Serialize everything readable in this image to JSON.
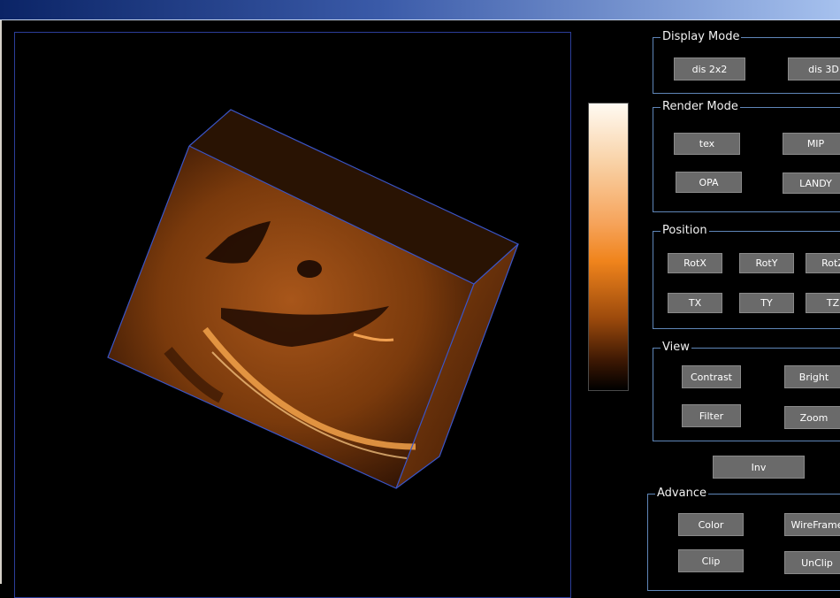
{
  "window": {
    "title": ""
  },
  "display_mode": {
    "title": "Display Mode",
    "buttons": [
      "dis 2x2",
      "dis 3D"
    ]
  },
  "render_mode": {
    "title": "Render Mode",
    "buttons": [
      "tex",
      "MIP",
      "OPA",
      "LANDY"
    ]
  },
  "position": {
    "title": "Position",
    "buttons": [
      "RotX",
      "RotY",
      "RotZ",
      "TX",
      "TY",
      "TZ"
    ]
  },
  "view": {
    "title": "View",
    "buttons": [
      "Contrast",
      "Bright",
      "Filter",
      "Zoom"
    ]
  },
  "inv_button": "Inv",
  "advance": {
    "title": "Advance",
    "buttons": [
      "Color",
      "WireFrame",
      "Clip",
      "UnClip"
    ]
  },
  "colormap": {
    "top_color": "#fffaf2",
    "mid_color": "#f0841c",
    "bottom_color": "#000000"
  }
}
